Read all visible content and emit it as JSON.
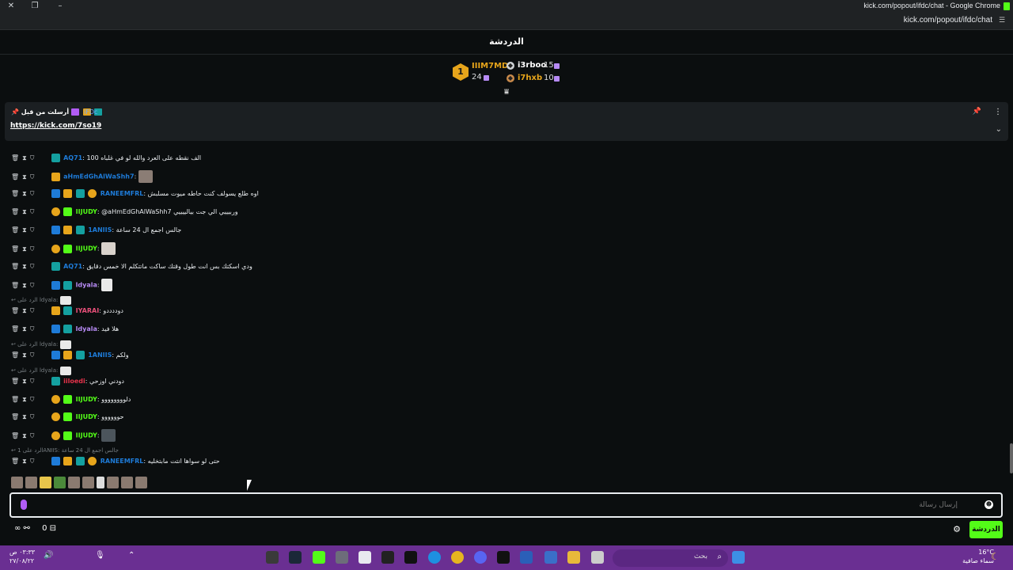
{
  "window": {
    "title": "kick.com/popout/ifdc/chat - Google Chrome",
    "url": "kick.com/popout/ifdc/chat"
  },
  "chat": {
    "header_title": "الدردشة",
    "leaderboard": [
      {
        "rank": "1",
        "name": "IIIM7MD",
        "count": "24"
      },
      {
        "name": "i3rboo",
        "count": "15"
      },
      {
        "name": "i7hxb",
        "count": "10"
      }
    ],
    "pinned": {
      "meta": "أرسلت من قبل",
      "user": "iFDc",
      "link": "https://kick.com/7so19"
    },
    "messages": [
      {
        "user": "AQ71",
        "color": "#1e7bd8",
        "text": "الف نقطه على العرد والله لو في غلباه 100"
      },
      {
        "user": "aHmEdGhAlWaShh7",
        "color": "#1e7bd8",
        "text": "",
        "emote": true
      },
      {
        "user": "RANEEMFRL",
        "color": "#1e7bd8",
        "text": "اوه طلع يسولف كنت حاطه ميوت مسلبش"
      },
      {
        "user": "IIJUDY",
        "color": "#53fc18",
        "text": "@aHmEdGhAlWaShh7 وربيييي الي جت بيالييييي"
      },
      {
        "user": "1ANIIS",
        "color": "#1e7bd8",
        "text": "جالس اجمع ال 24 ساعة"
      },
      {
        "user": "IIJUDY",
        "color": "#53fc18",
        "text": "",
        "emote": true
      },
      {
        "user": "AQ71",
        "color": "#1e7bd8",
        "text": "ودي اسكتك بس انت طول وقتك ساكت ماتتكلم الا خمس دقايق"
      },
      {
        "user": "ldyala",
        "color": "#b78bf5",
        "text": "",
        "emote": true
      },
      {
        "user": "IYARAI",
        "color": "#e8507a",
        "text": "دوددددو",
        "reply": "الرد على ldyala:"
      },
      {
        "user": "ldyala",
        "color": "#b78bf5",
        "text": "هلا فيد"
      },
      {
        "user": "1ANIIS",
        "color": "#1e7bd8",
        "text": "ولكم",
        "reply": "الرد على ldyala:"
      },
      {
        "user": "iiloedi",
        "color": "#e5324a",
        "text": "دودني اوزحي",
        "reply": "الرد على ldyala:"
      },
      {
        "user": "IIJUDY",
        "color": "#53fc18",
        "text": "دلوووووووو"
      },
      {
        "user": "IIJUDY",
        "color": "#53fc18",
        "text": "حوووووو"
      },
      {
        "user": "IIJUDY",
        "color": "#53fc18",
        "text": "",
        "emote": true
      },
      {
        "user": "RANEEMFRL",
        "color": "#1e7bd8",
        "text": "حتى لو سواها انتت مابتخليه",
        "reply": "الرد على 1ANIIS: جالس اجمع ال 24 ساعة"
      }
    ],
    "composer_placeholder": "إرسال رسالة",
    "chat_button": "الدردشة",
    "footer_count": "0"
  },
  "taskbar": {
    "search_placeholder": "بحث",
    "weather_temp": "16°C",
    "weather_desc": "سماء صافية",
    "time": "٠٣:٣٣ ص",
    "date": "٢٧/٠٨/٢٢"
  },
  "colors": {
    "accent": "#53fc18",
    "taskbar": "#6a2f92"
  }
}
